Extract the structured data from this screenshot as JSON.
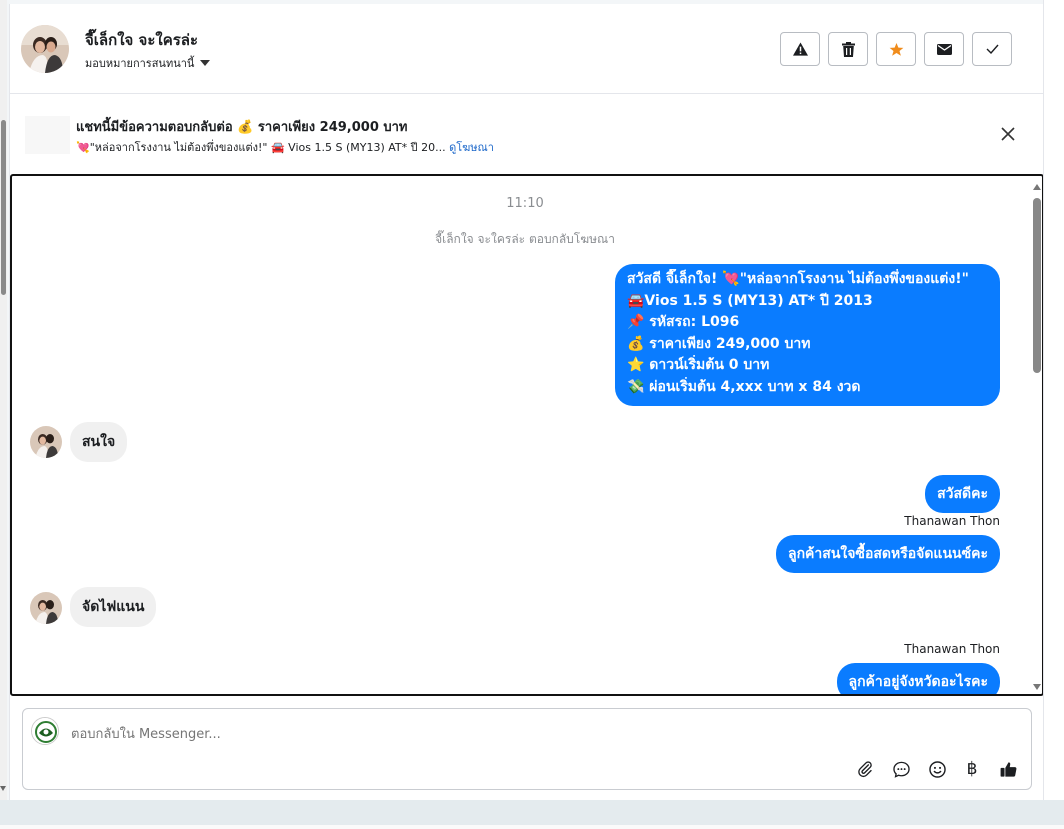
{
  "header": {
    "contact_name": "จี๊เล็กใจ จะใครล่ะ",
    "assign_label": "มอบหมายการสนทนานี้",
    "buttons": [
      {
        "name": "report-button",
        "icon": "warning-icon"
      },
      {
        "name": "delete-button",
        "icon": "trash-icon"
      },
      {
        "name": "star-button",
        "icon": "star-icon"
      },
      {
        "name": "mail-button",
        "icon": "envelope-icon"
      },
      {
        "name": "done-button",
        "icon": "check-icon"
      }
    ]
  },
  "ad": {
    "title": "แชทนี้มีข้อความตอบกลับต่อ 💰 ราคาเพียง 249,000 บาท",
    "subtitle": "💘\"หล่อจากโรงงาน ไม่ต้องพึ่งของแต่ง!\" 🚘 Vios 1.5 S (MY13) AT* ปี 20...",
    "link": "ดูโฆษณา"
  },
  "chat": {
    "timestamp": "11:10",
    "system_message": "จี๊เล็กใจ จะใครล่ะ ตอบกลับโฆษณา",
    "first_message_lines": [
      "สวัสดี จี๊เล็กใจ! 💘\"หล่อจากโรงงาน ไม่ต้องพึ่งของแต่ง!\"",
      "🚘Vios 1.5 S (MY13) AT* ปี 2013",
      "📌 รหัสรถ: L096",
      "💰 ราคาเพียง 249,000 บาท",
      "⭐ ดาวน์เริ่มต้น 0 บาท",
      "💸 ผ่อนเริ่มต้น 4,xxx บาท x 84 งวด"
    ],
    "incoming_1": "สนใจ",
    "outgoing_1": "สวัสดีคะ",
    "sender_1": "Thanawan Thon",
    "outgoing_2": "ลูกค้าสนใจซื้อสดหรือจัดแนนซ์คะ",
    "incoming_2": "จัดไฟแนน",
    "sender_2": "Thanawan Thon",
    "outgoing_3": "ลูกค้าอยู่จังหวัดอะไรคะ"
  },
  "composer": {
    "placeholder": "ตอบกลับใน Messenger...",
    "icons": [
      "paperclip-icon",
      "chat-bubble-icon",
      "emoji-icon",
      "baht-icon",
      "thumbs-up-icon"
    ]
  },
  "colors": {
    "bubble_out": "#0a7cff",
    "bubble_in": "#f0f0f0",
    "star": "#f08c1c",
    "link": "#1a66c9"
  }
}
